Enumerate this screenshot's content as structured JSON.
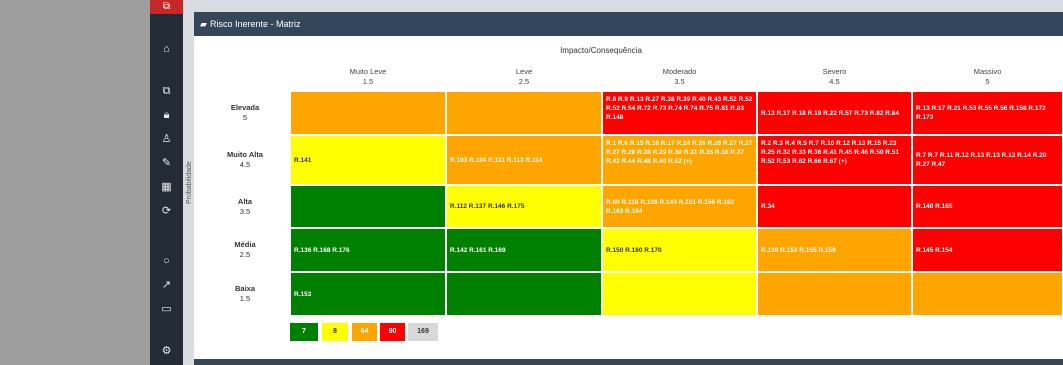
{
  "panel": {
    "title": "Risco Inerente - Matriz"
  },
  "matrix": {
    "impact_title": "Impacto/Consequência",
    "probability_title": "Probabilidade",
    "columns": [
      {
        "name": "Muito Leve",
        "value": "1.5"
      },
      {
        "name": "Leve",
        "value": "2.5"
      },
      {
        "name": "Moderado",
        "value": "3.5"
      },
      {
        "name": "Severo",
        "value": "4.5"
      },
      {
        "name": "Massivo",
        "value": "5"
      }
    ],
    "rows": [
      {
        "name": "Elevada",
        "value": "5"
      },
      {
        "name": "Muito Alta",
        "value": "4.5"
      },
      {
        "name": "Alta",
        "value": "3.5"
      },
      {
        "name": "Média",
        "value": "2.5"
      },
      {
        "name": "Baixa",
        "value": "1.5"
      }
    ],
    "cells": [
      [
        "",
        "",
        "R.8 R.9 R.13 R.27 R.38 R.39 R.40 R.43 R.52 R.52 R.52 R.54 R.72 R.73 R.74 R.74 R.75 R.81 R.83 R.148",
        "R.13 R.17 R.18 R.19 R.22 R.57 R.73 R.82 R.84",
        "R.13 R.17 R.21 R.53 R.55 R.56 R.158 R.172 R.173"
      ],
      [
        "R.141",
        "R.103 R.104 R.111 R.113 R.114",
        "R.1 R.6 R.15 R.16 R.17 R.24 R.26 R.26 R.27 R.27 R.27 R.28 R.28 R.29 R.30 R.31 R.35 R.36 R.37 R.42 R.44 R.48 R.49 R.52 (+)",
        "R.2 R.3 R.4 R.5 R.7 R.10 R.12 R.13 R.15 R.23 R.25 R.32 R.33 R.36 R.41 R.45 R.46 R.50 R.51 R.52 R.53 R.62 R.66 R.67 (+)",
        "R.7 R.7 R.11 R.12 R.13 R.13 R.13 R.14 R.20 R.27 R.47"
      ],
      [
        "",
        "R.112 R.137 R.146 R.175",
        "R.60 R.118 R.128 R.143 R.151 R.156 R.162 R.163 R.164",
        "R.34",
        "R.140 R.165"
      ],
      [
        "R.136 R.168 R.176",
        "R.142 R.161 R.169",
        "R.150 R.160 R.170",
        "R.139 R.153 R.155 R.159",
        "R.145 R.154"
      ],
      [
        "R.153",
        "",
        "",
        "",
        ""
      ]
    ],
    "cell_colors": [
      [
        "#ffa500",
        "#ffa500",
        "#ff0000",
        "#ff0000",
        "#ff0000"
      ],
      [
        "#ffff00",
        "#ffa500",
        "#ffa500",
        "#ff0000",
        "#ff0000"
      ],
      [
        "#008000",
        "#ffff00",
        "#ffa500",
        "#ff0000",
        "#ff0000"
      ],
      [
        "#008000",
        "#008000",
        "#ffff00",
        "#ffa500",
        "#ff0000"
      ],
      [
        "#008000",
        "#008000",
        "#ffff00",
        "#ffa500",
        "#ffa500"
      ]
    ]
  },
  "legend": [
    {
      "label": "7",
      "color": "#008000",
      "text_color": "#ffffff"
    },
    {
      "label": "8",
      "color": "#ffff00",
      "text_color": "#333333"
    },
    {
      "label": "64",
      "color": "#ffa500",
      "text_color": "#ffffff"
    },
    {
      "label": "90",
      "color": "#ff0000",
      "text_color": "#ffffff"
    },
    {
      "label": "169",
      "color": "#d9d9d9",
      "text_color": "#333333"
    }
  ],
  "sidebar_icons": [
    "home-icon",
    "hierarchy-icon",
    "lock-icon",
    "user-lock-icon",
    "edit-icon",
    "grid-icon",
    "refresh-icon",
    "lightbulb-icon",
    "chart-icon",
    "folder-icon",
    "settings-icon"
  ]
}
